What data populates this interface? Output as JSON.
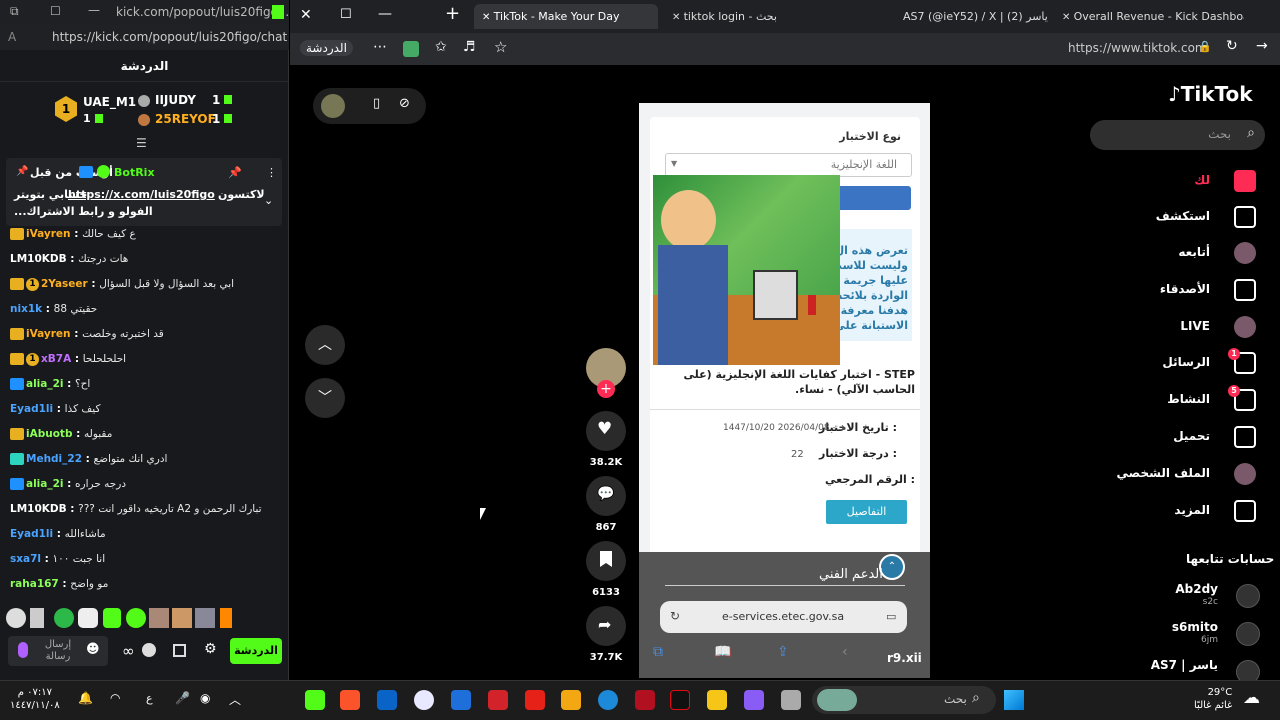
{
  "kick": {
    "window_title": "kick.com/popout/luis20figo...",
    "url": "https://kick.com/popout/luis20figo/chat",
    "chat_title": "الدردشة",
    "leaders": [
      {
        "name": "UAE_M1",
        "count": "1"
      },
      {
        "name": "IIJUDY",
        "count": "1"
      },
      {
        "name": "25REYOF",
        "count": "1"
      }
    ],
    "leader_rank": "1",
    "leader_sub_count": "1",
    "pinned": {
      "author": "BotRix",
      "prefix": "أرسلت من قبل",
      "link": "https://x.com/luis20figo",
      "text_before": "لاكتسون",
      "text_line2": "حسابي بتويتر",
      "text_line3": "...الفولو و رابط الاشتراك"
    },
    "messages": [
      {
        "user": "iVayren",
        "text": "ع كيف حالك",
        "color": "#ffb020"
      },
      {
        "user": "LM10KDB",
        "text": "هات درجتك",
        "color": "#ffffff"
      },
      {
        "user": "2Yaseer",
        "text": "ابي بعد السؤال ولا قبل السؤال",
        "color": "#ffb020"
      },
      {
        "user": "nix1k",
        "text": "88 حقيتي",
        "color": "#4aa3ff"
      },
      {
        "user": "iVayren",
        "text": "قد اختبرته وخلصت",
        "color": "#ffb020"
      },
      {
        "user": "xB7A",
        "text": "احلحلحلحا",
        "color": "#c070ff"
      },
      {
        "user": "alia_2i",
        "text": "اح؟",
        "color": "#8cff5a"
      },
      {
        "user": "Eyad1li",
        "text": "كيف كذا",
        "color": "#4aa3ff"
      },
      {
        "user": "iAbuotb",
        "text": "مقبوله",
        "color": "#8cff5a"
      },
      {
        "user": "Mehdi_22",
        "text": "ادري انك متواضع",
        "color": "#4aa3ff"
      },
      {
        "user": "alia_2i",
        "text": "درجه حراره",
        "color": "#8cff5a"
      },
      {
        "user": "LM10KDB",
        "text": "??? تاريخيه داقور انت A2 تبارك الرحمن و",
        "color": "#ffffff"
      },
      {
        "user": "Eyad1li",
        "text": "ماشاءالله",
        "color": "#4aa3ff"
      },
      {
        "user": "sxa7l",
        "text": "انا جبت ١٠٠",
        "color": "#4aa3ff"
      },
      {
        "user": "raha167",
        "text": "مو واضح",
        "color": "#8cff5a"
      }
    ],
    "xb7a_rank": "1",
    "yaseer_rank": "1",
    "send_placeholder": "إرسال رسالة",
    "chat_button": "الدردشة"
  },
  "browser": {
    "tabs": [
      {
        "label": "TikTok - Make Your Day",
        "active": true
      },
      {
        "label": "tiktok login - بحث",
        "active": false
      },
      {
        "label": "AS7 (@ieY52) / X | (2) ياسر",
        "active": false
      },
      {
        "label": "Overall Revenue - Kick Dashboard",
        "active": false
      }
    ],
    "url": "https://www.tiktok.com",
    "copilot_label": "الدردشة"
  },
  "tiktok": {
    "logo": "TikTok",
    "search_placeholder": "بحث",
    "nav": [
      {
        "label": "لك",
        "icon": "home-icon",
        "active": true
      },
      {
        "label": "استكشف",
        "icon": "compass-icon"
      },
      {
        "label": "أتابعه",
        "icon": "avatar-icon"
      },
      {
        "label": "الأصدقاء",
        "icon": "friends-icon"
      },
      {
        "label": "LIVE",
        "icon": "live-icon"
      },
      {
        "label": "الرسائل",
        "icon": "messages-icon",
        "badge": "1"
      },
      {
        "label": "النشاط",
        "icon": "activity-icon",
        "badge": "5"
      },
      {
        "label": "تحميل",
        "icon": "upload-icon"
      },
      {
        "label": "الملف الشخصي",
        "icon": "profile-icon"
      },
      {
        "label": "المزيد",
        "icon": "more-icon"
      }
    ],
    "following_title": "حسابات تتابعها",
    "following": [
      {
        "name": "Ab2dy",
        "sub": "s2c"
      },
      {
        "name": "s6mito",
        "sub": "6jm"
      },
      {
        "name": "AS7 | ياسر",
        "sub": ""
      }
    ],
    "actions": {
      "likes": "38.2K",
      "comments": "867",
      "saves": "6133",
      "shares": "37.7K"
    }
  },
  "video": {
    "exam_type_label": "نوع الاختبار",
    "exam_select": "اللغة الإنجليزية",
    "notice_lines": [
      "تعرض هذه ال",
      "وليست للاست",
      "عليها جريمة",
      "الواردة بلائحة",
      "هدفنا معرفة",
      "الاستبانة على"
    ],
    "exam_title": "STEP - اختبار كفايات اللغة الإنجليزية (على الحاسب الآلي) - نساء.",
    "date_label": "تاريخ الاختبار :",
    "date_value": "1447/10/20 هـ - 2026/04/08",
    "grade_label": "درجة الاختبار :",
    "grade_value": "22",
    "ref_label": "الرقم المرجعي :",
    "details_button": "التفاصيل",
    "support_text": "الدعم الفني",
    "site_url": "e-services.etec.gov.sa",
    "watermark": "r9.xii"
  },
  "taskbar": {
    "time": "٠٧:١٧ م",
    "date": "١٤٤٧/١١/٠٨",
    "weather_temp": "29°C",
    "weather_desc": "غائم غالبًا",
    "search": "بحث",
    "lang": "ع"
  }
}
